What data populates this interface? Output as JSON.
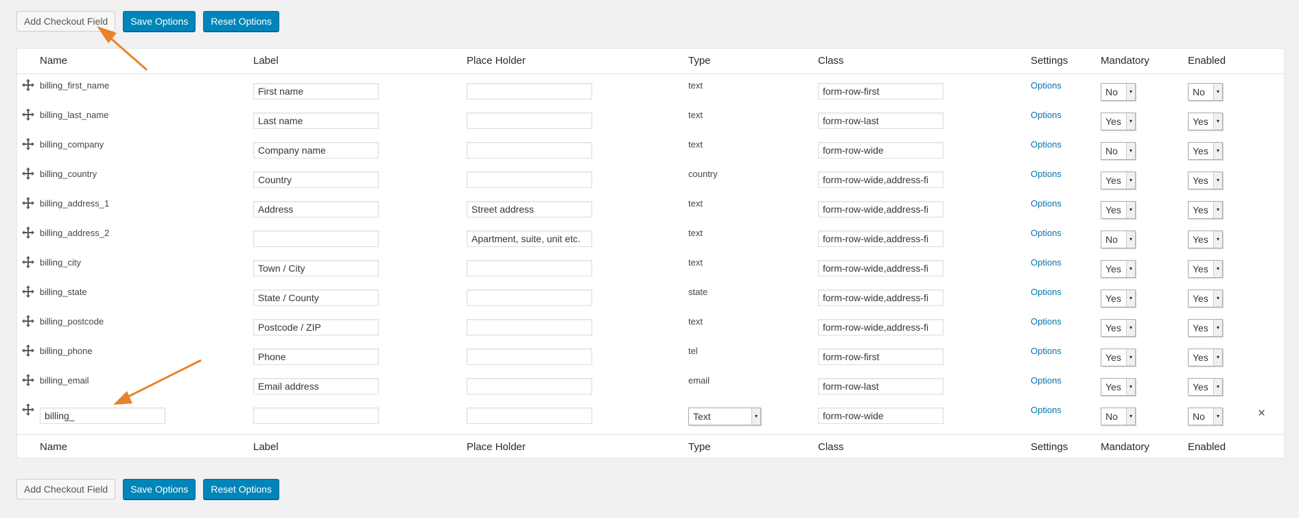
{
  "buttons": {
    "add_field": "Add Checkout Field",
    "save": "Save Options",
    "reset": "Reset Options"
  },
  "columns": {
    "name": "Name",
    "label": "Label",
    "placeholder": "Place Holder",
    "type": "Type",
    "class": "Class",
    "settings": "Settings",
    "mandatory": "Mandatory",
    "enabled": "Enabled"
  },
  "fields": [
    {
      "name": "billing_first_name",
      "label": "First name",
      "placeholder": "",
      "type": "text",
      "class": "form-row-first",
      "settings": "Options",
      "mandatory": "No",
      "enabled": "No"
    },
    {
      "name": "billing_last_name",
      "label": "Last name",
      "placeholder": "",
      "type": "text",
      "class": "form-row-last",
      "settings": "Options",
      "mandatory": "Yes",
      "enabled": "Yes"
    },
    {
      "name": "billing_company",
      "label": "Company name",
      "placeholder": "",
      "type": "text",
      "class": "form-row-wide",
      "settings": "Options",
      "mandatory": "No",
      "enabled": "Yes"
    },
    {
      "name": "billing_country",
      "label": "Country",
      "placeholder": "",
      "type": "country",
      "class": "form-row-wide,address-fi",
      "settings": "Options",
      "mandatory": "Yes",
      "enabled": "Yes"
    },
    {
      "name": "billing_address_1",
      "label": "Address",
      "placeholder": "Street address",
      "type": "text",
      "class": "form-row-wide,address-fi",
      "settings": "Options",
      "mandatory": "Yes",
      "enabled": "Yes"
    },
    {
      "name": "billing_address_2",
      "label": "",
      "placeholder": "Apartment, suite, unit etc.",
      "type": "text",
      "class": "form-row-wide,address-fi",
      "settings": "Options",
      "mandatory": "No",
      "enabled": "Yes"
    },
    {
      "name": "billing_city",
      "label": "Town / City",
      "placeholder": "",
      "type": "text",
      "class": "form-row-wide,address-fi",
      "settings": "Options",
      "mandatory": "Yes",
      "enabled": "Yes"
    },
    {
      "name": "billing_state",
      "label": "State / County",
      "placeholder": "",
      "type": "state",
      "class": "form-row-wide,address-fi",
      "settings": "Options",
      "mandatory": "Yes",
      "enabled": "Yes"
    },
    {
      "name": "billing_postcode",
      "label": "Postcode / ZIP",
      "placeholder": "",
      "type": "text",
      "class": "form-row-wide,address-fi",
      "settings": "Options",
      "mandatory": "Yes",
      "enabled": "Yes"
    },
    {
      "name": "billing_phone",
      "label": "Phone",
      "placeholder": "",
      "type": "tel",
      "class": "form-row-first",
      "settings": "Options",
      "mandatory": "Yes",
      "enabled": "Yes"
    },
    {
      "name": "billing_email",
      "label": "Email address",
      "placeholder": "",
      "type": "email",
      "class": "form-row-last",
      "settings": "Options",
      "mandatory": "Yes",
      "enabled": "Yes"
    }
  ],
  "new_field": {
    "name": "billing_",
    "label": "",
    "placeholder": "",
    "type": "Text",
    "class": "form-row-wide",
    "settings": "Options",
    "mandatory": "No",
    "enabled": "No",
    "remove": "×"
  },
  "icons": {
    "move": "move-icon",
    "close": "close-icon",
    "select_arrow": "▾"
  },
  "colors": {
    "primary": "#0085ba",
    "link": "#0073aa",
    "annotation_arrow": "#e8832a"
  }
}
